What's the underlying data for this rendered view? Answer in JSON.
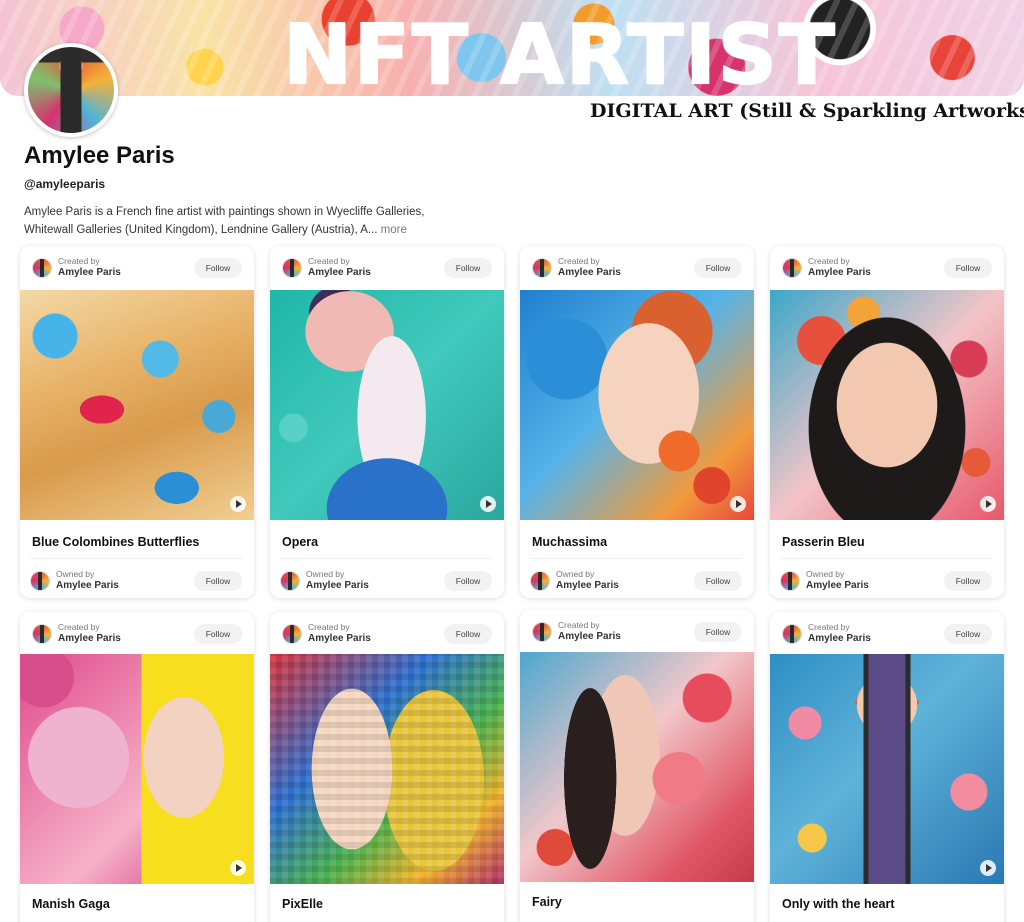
{
  "banner": {
    "title": "NFT ARTIST",
    "subtitle": "DIGITAL ART (Still & Sparkling Artworks)"
  },
  "profile": {
    "name": "Amylee Paris",
    "handle": "@amyleeparis",
    "bio": "Amylee Paris is a French fine artist with paintings shown in Wyecliffe Galleries, Whitewall Galleries (United Kingdom), Lendnine Gallery (Austria), A...",
    "more_label": "more"
  },
  "labels": {
    "created_by": "Created by",
    "owned_by": "Owned by",
    "follow": "Follow"
  },
  "cards": [
    {
      "title": "Blue Colombines Butterflies",
      "creator": "Amylee Paris",
      "owner": "Amylee Paris"
    },
    {
      "title": "Opera",
      "creator": "Amylee Paris",
      "owner": "Amylee Paris"
    },
    {
      "title": "Muchassima",
      "creator": "Amylee Paris",
      "owner": "Amylee Paris"
    },
    {
      "title": "Passerin Bleu",
      "creator": "Amylee Paris",
      "owner": "Amylee Paris"
    },
    {
      "title": "Manish Gaga",
      "creator": "Amylee Paris"
    },
    {
      "title": "PixElle",
      "creator": "Amylee Paris"
    },
    {
      "title": "Fairy",
      "creator": "Amylee Paris"
    },
    {
      "title": "Only with the heart",
      "creator": "Amylee Paris"
    }
  ],
  "icons": {
    "video": "play-icon"
  }
}
